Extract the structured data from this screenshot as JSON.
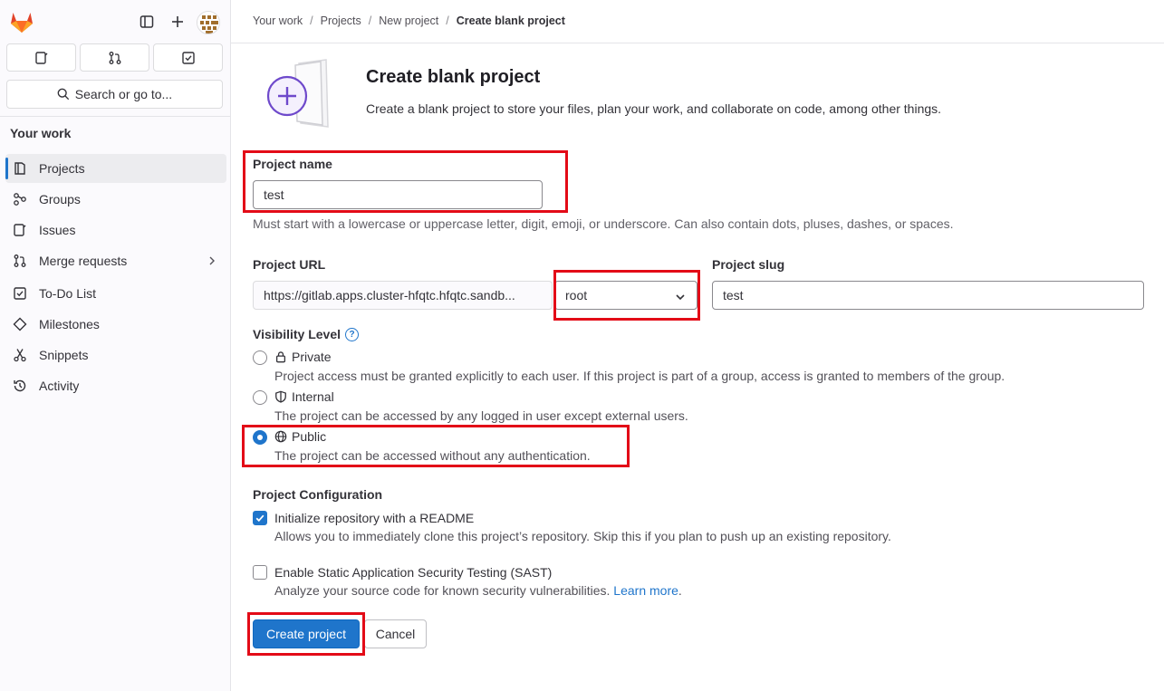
{
  "sidebar": {
    "search_label": "Search or go to...",
    "section_title": "Your work",
    "items": [
      {
        "label": "Projects",
        "icon": "project-icon",
        "active": true
      },
      {
        "label": "Groups",
        "icon": "group-icon"
      },
      {
        "label": "Issues",
        "icon": "issues-icon"
      },
      {
        "label": "Merge requests",
        "icon": "merge-request-icon"
      },
      {
        "label": "To-Do List",
        "icon": "todo-icon"
      },
      {
        "label": "Milestones",
        "icon": "milestone-icon"
      },
      {
        "label": "Snippets",
        "icon": "snippet-icon"
      },
      {
        "label": "Activity",
        "icon": "history-icon"
      }
    ]
  },
  "breadcrumb": {
    "items": [
      "Your work",
      "Projects",
      "New project",
      "Create blank project"
    ]
  },
  "header": {
    "title": "Create blank project",
    "description": "Create a blank project to store your files, plan your work, and collaborate on code, among other things."
  },
  "form": {
    "project_name_label": "Project name",
    "project_name_value": "test",
    "project_name_help": "Must start with a lowercase or uppercase letter, digit, emoji, or underscore. Can also contain dots, pluses, dashes, or spaces.",
    "project_url_label": "Project URL",
    "project_url_value": "https://gitlab.apps.cluster-hfqtc.hfqtc.sandb...",
    "namespace_value": "root",
    "project_slug_label": "Project slug",
    "project_slug_value": "test",
    "visibility_label": "Visibility Level",
    "visibility_help_icon": "?",
    "visibility": [
      {
        "label": "Private",
        "icon": "lock-icon",
        "description": "Project access must be granted explicitly to each user. If this project is part of a group, access is granted to members of the group.",
        "checked": false
      },
      {
        "label": "Internal",
        "icon": "shield-icon",
        "description": "The project can be accessed by any logged in user except external users.",
        "checked": false
      },
      {
        "label": "Public",
        "icon": "earth-icon",
        "description": "The project can be accessed without any authentication.",
        "checked": true
      }
    ],
    "config_label": "Project Configuration",
    "readme_label": "Initialize repository with a README",
    "readme_checked": true,
    "readme_desc": "Allows you to immediately clone this project’s repository. Skip this if you plan to push up an existing repository.",
    "sast_label": "Enable Static Application Security Testing (SAST)",
    "sast_checked": false,
    "sast_desc": "Analyze your source code for known security vulnerabilities.",
    "sast_link": "Learn more",
    "sast_link_suffix": ".",
    "create_button": "Create project",
    "cancel_button": "Cancel"
  },
  "colors": {
    "accent": "#1f75cb",
    "highlight": "#e30b17",
    "illustration": "#6e49cb"
  }
}
